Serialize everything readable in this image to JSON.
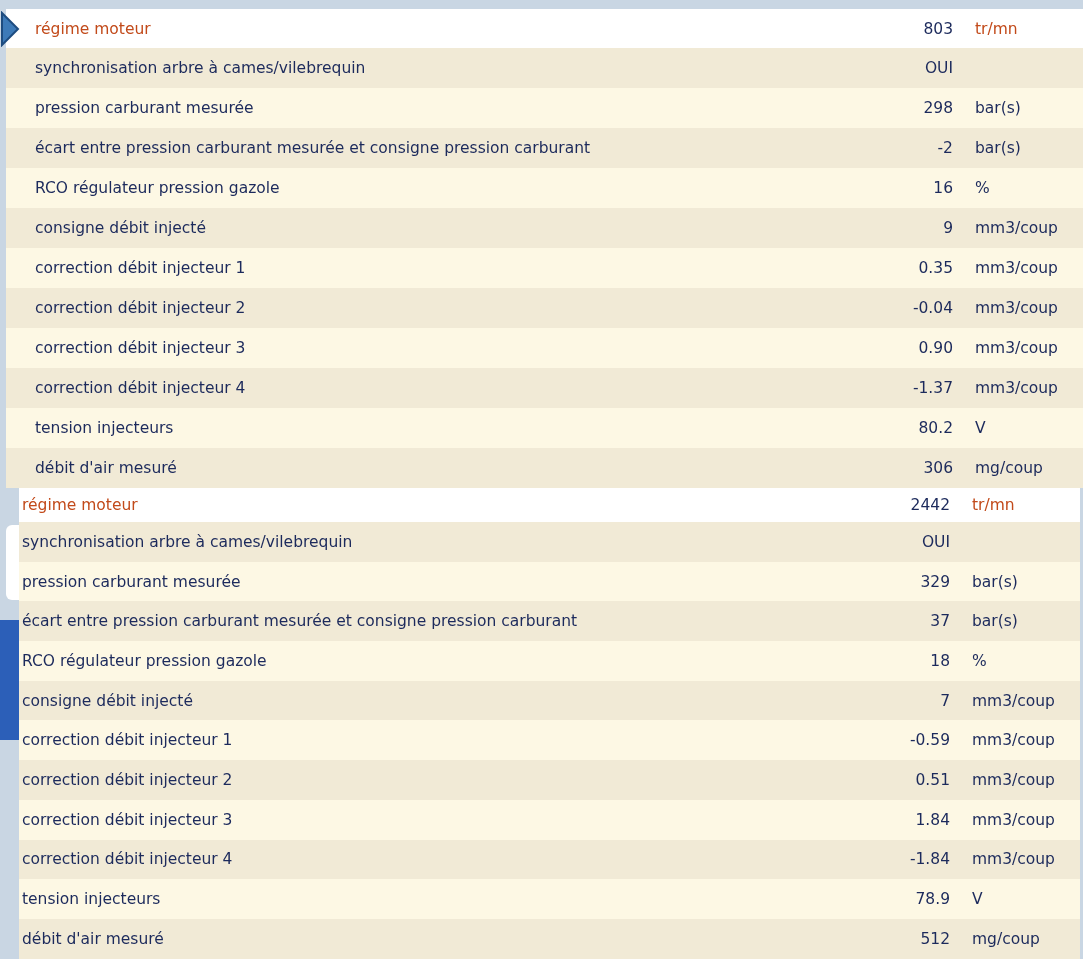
{
  "panels": [
    {
      "current_row_marker": true,
      "rows": [
        {
          "label": "régime moteur",
          "value": "803",
          "unit": "tr/mn",
          "selected": true
        },
        {
          "label": "synchronisation arbre à cames/vilebrequin",
          "value": "OUI",
          "selected": false
        },
        {
          "label": "pression carburant mesurée",
          "value": "298",
          "unit": "bar(s)",
          "selected": false
        },
        {
          "label": "écart entre pression carburant mesurée et consigne pression carburant",
          "value": "-2",
          "unit": "bar(s)",
          "selected": false
        },
        {
          "label": "RCO régulateur pression gazole",
          "value": "16",
          "unit": "%",
          "selected": false
        },
        {
          "label": "consigne débit injecté",
          "value": "9",
          "unit": "mm3/coup",
          "selected": false
        },
        {
          "label": "correction débit injecteur 1",
          "value": "0.35",
          "unit": "mm3/coup",
          "selected": false
        },
        {
          "label": "correction débit injecteur 2",
          "value": "-0.04",
          "unit": "mm3/coup",
          "selected": false
        },
        {
          "label": "correction débit injecteur 3",
          "value": "0.90",
          "unit": "mm3/coup",
          "selected": false
        },
        {
          "label": "correction débit injecteur 4",
          "value": "-1.37",
          "unit": "mm3/coup",
          "selected": false
        },
        {
          "label": "tension injecteurs",
          "value": "80.2",
          "unit": "V",
          "selected": false
        },
        {
          "label": "débit d'air mesuré",
          "value": "306",
          "unit": "mg/coup",
          "selected": false
        }
      ]
    },
    {
      "current_row_marker": false,
      "rows": [
        {
          "label": "régime moteur",
          "value": "2442",
          "unit": "tr/mn",
          "selected": true
        },
        {
          "label": "synchronisation arbre à cames/vilebrequin",
          "value": "OUI",
          "selected": false
        },
        {
          "label": "pression carburant mesurée",
          "value": "329",
          "unit": "bar(s)",
          "selected": false
        },
        {
          "label": "écart entre pression carburant mesurée et consigne pression carburant",
          "value": "37",
          "unit": "bar(s)",
          "selected": false
        },
        {
          "label": "RCO régulateur pression gazole",
          "value": "18",
          "unit": "%",
          "selected": false
        },
        {
          "label": "consigne débit injecté",
          "value": "7",
          "unit": "mm3/coup",
          "selected": false
        },
        {
          "label": "correction débit injecteur 1",
          "value": "-0.59",
          "unit": "mm3/coup",
          "selected": false
        },
        {
          "label": "correction débit injecteur 2",
          "value": "0.51",
          "unit": "mm3/coup",
          "selected": false
        },
        {
          "label": "correction débit injecteur 3",
          "value": "1.84",
          "unit": "mm3/coup",
          "selected": false
        },
        {
          "label": "correction débit injecteur 4",
          "value": "-1.84",
          "unit": "mm3/coup",
          "selected": false
        },
        {
          "label": "tension injecteurs",
          "value": "78.9",
          "unit": "V",
          "selected": false
        },
        {
          "label": "débit d'air mesuré",
          "value": "512",
          "unit": "mg/coup",
          "selected": false
        }
      ]
    }
  ]
}
